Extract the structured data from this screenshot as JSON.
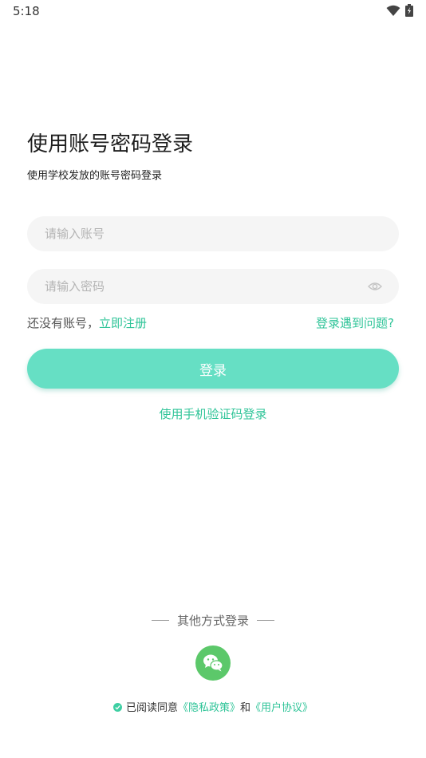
{
  "status_bar": {
    "time": "5:18"
  },
  "header": {
    "title": "使用账号密码登录",
    "subtitle": "使用学校发放的账号密码登录"
  },
  "form": {
    "account_placeholder": "请输入账号",
    "password_placeholder": "请输入密码",
    "no_account_text": "还没有账号，",
    "register_label": "立即注册",
    "trouble_label": "登录遇到问题?",
    "login_button_label": "登录",
    "sms_login_label": "使用手机验证码登录"
  },
  "other_login": {
    "label": "其他方式登录",
    "icons": [
      "wechat-icon"
    ]
  },
  "agreement": {
    "checked": true,
    "prefix": "已阅读同意",
    "privacy_label": "《隐私政策》",
    "conjunction": "和",
    "terms_label": "《用户协议》"
  },
  "colors": {
    "accent": "#2fc498",
    "button": "#66dfc4",
    "field_bg": "#f5f5f5",
    "wechat": "#5cc86a"
  }
}
